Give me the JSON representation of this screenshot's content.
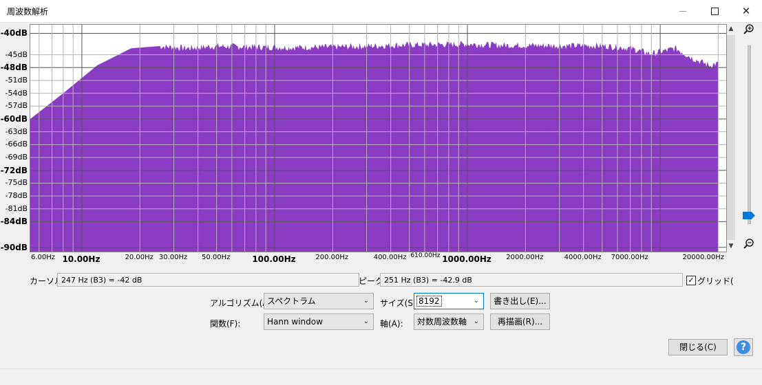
{
  "window": {
    "title": "周波数解析",
    "minimize_icon": "minimize-icon",
    "maximize_icon": "maximize-icon",
    "close_icon": "close-icon"
  },
  "chart_data": {
    "type": "area",
    "title": "",
    "xlabel": "",
    "ylabel": "",
    "x_scale": "log",
    "xlim": [
      5.4,
      22000
    ],
    "ylim": [
      -91,
      -38
    ],
    "grid": true,
    "fill_color": "#8a3cc3",
    "y_ticks": [
      {
        "label": "-40dB",
        "value": -40,
        "major": true
      },
      {
        "label": "-45dB",
        "value": -45,
        "major": false
      },
      {
        "label": "-48dB",
        "value": -48,
        "major": true
      },
      {
        "label": "-51dB",
        "value": -51,
        "major": false
      },
      {
        "label": "-54dB",
        "value": -54,
        "major": false
      },
      {
        "label": "-57dB",
        "value": -57,
        "major": false
      },
      {
        "label": "-60dB",
        "value": -60,
        "major": true
      },
      {
        "label": "-63dB",
        "value": -63,
        "major": false
      },
      {
        "label": "-66dB",
        "value": -66,
        "major": false
      },
      {
        "label": "-69dB",
        "value": -69,
        "major": false
      },
      {
        "label": "-72dB",
        "value": -72,
        "major": true
      },
      {
        "label": "-75dB",
        "value": -75,
        "major": false
      },
      {
        "label": "-78dB",
        "value": -78,
        "major": false
      },
      {
        "label": "-81dB",
        "value": -81,
        "major": false
      },
      {
        "label": "-84dB",
        "value": -84,
        "major": true
      },
      {
        "label": "-90dB",
        "value": -90,
        "major": true
      }
    ],
    "x_ticks": [
      {
        "label": "6.00Hz",
        "value": 6,
        "kind": "minor"
      },
      {
        "label": "10.00Hz",
        "value": 10,
        "kind": "major"
      },
      {
        "label": "20.00Hz",
        "value": 20,
        "kind": "minor"
      },
      {
        "label": "30.00Hz",
        "value": 30,
        "kind": "minor"
      },
      {
        "label": "50.00Hz",
        "value": 50,
        "kind": "minor"
      },
      {
        "label": "100.00Hz",
        "value": 100,
        "kind": "major"
      },
      {
        "label": "200.00Hz",
        "value": 200,
        "kind": "minor"
      },
      {
        "label": "400.00Hz",
        "value": 400,
        "kind": "minor"
      },
      {
        "label": "610.00Hz",
        "value": 610,
        "kind": "tiny"
      },
      {
        "label": "1000.00Hz",
        "value": 1000,
        "kind": "major"
      },
      {
        "label": "2000.00Hz",
        "value": 2000,
        "kind": "minor"
      },
      {
        "label": "4000.00Hz",
        "value": 4000,
        "kind": "minor"
      },
      {
        "label": "7000.00Hz",
        "value": 7000,
        "kind": "minor"
      },
      {
        "label": "20000.00Hz",
        "value": 20000,
        "kind": "minor"
      }
    ],
    "series": [
      {
        "x": [
          5.4,
          8,
          12,
          18,
          25,
          35,
          50,
          80,
          120,
          200,
          300,
          400,
          500,
          700,
          1000,
          1500,
          2000,
          3000,
          5000,
          7000,
          9000,
          12000,
          15000,
          18000,
          20000
        ],
        "y": [
          -60,
          -54,
          -47.5,
          -43.5,
          -43,
          -43.5,
          -43,
          -43.2,
          -43.3,
          -43.2,
          -43,
          -42.8,
          -42.7,
          -42.6,
          -42.5,
          -42.8,
          -42.8,
          -42.9,
          -42.9,
          -43.5,
          -44.8,
          -43.5,
          -46,
          -47.5,
          -47
        ]
      }
    ]
  },
  "cursor": {
    "label": "カーソル:",
    "value": "247 Hz (B3) = -42 dB"
  },
  "peak": {
    "label": "ピーク:",
    "value": "251 Hz (B3) = -42.9 dB"
  },
  "grid_option": {
    "label": "グリッド(",
    "checked": true
  },
  "algorithm": {
    "label": "アルゴリズム(A):",
    "value": "スペクトラム"
  },
  "size": {
    "label": "サイズ(S):",
    "value": "8192"
  },
  "function": {
    "label": "関数(F):",
    "value": "Hann window"
  },
  "axis": {
    "label": "軸(A):",
    "value": "対数周波数軸"
  },
  "buttons": {
    "export": "書き出し(E)...",
    "redraw": "再描画(R)...",
    "close": "閉じる(C)",
    "help": "?"
  },
  "zoom": {
    "zoom_in_icon": "zoom-in-icon",
    "zoom_out_icon": "zoom-out-icon",
    "level": 0.05
  }
}
